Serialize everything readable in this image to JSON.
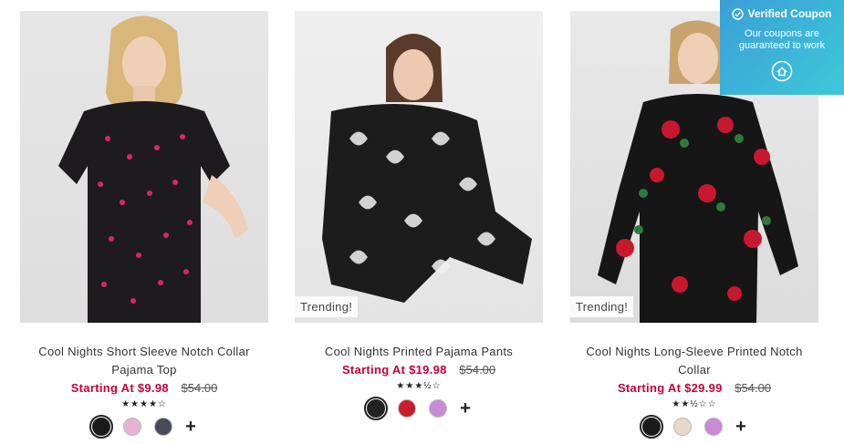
{
  "products": [
    {
      "title": "Cool Nights Short Sleeve Notch Collar Pajama Top",
      "price_now": "Starting At $9.98",
      "price_was": "$54.00",
      "stars": "★★★★☆",
      "rating": 4,
      "trending": "",
      "swatch_colors": [
        "#1a1a1a",
        "#e6b3d3",
        "#4a4a5a"
      ],
      "more_label": "+"
    },
    {
      "title": "Cool Nights Printed Pajama Pants",
      "price_now": "Starting At $19.98",
      "price_was": "$54.00",
      "stars": "★★★½☆",
      "rating": 3.5,
      "trending": "Trending!",
      "swatch_colors": [
        "#222222",
        "#c8202a",
        "#c98ad8"
      ],
      "more_label": "+"
    },
    {
      "title": "Cool Nights Long-Sleeve Printed Notch Collar",
      "price_now": "Starting At $29.99",
      "price_was": "$54.00",
      "stars": "★★½☆☆",
      "rating": 2.5,
      "trending": "Trending!",
      "swatch_colors": [
        "#1a1a1a",
        "#e8d9c6",
        "#c98ad8"
      ],
      "more_label": "+"
    }
  ],
  "coupon_badge": {
    "heading": "Verified Coupon",
    "body": "Our coupons are guaranteed to work"
  },
  "colors": {
    "price_accent": "#c4003c",
    "badge_gradient_start": "#3a9fd8",
    "badge_gradient_end": "#3ec8d8"
  }
}
